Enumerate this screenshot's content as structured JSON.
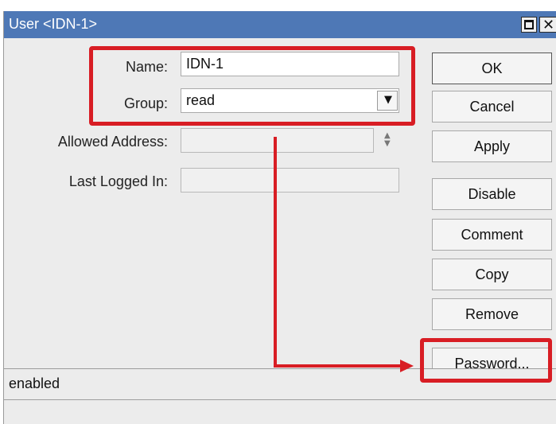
{
  "window": {
    "title": "User <IDN-1>"
  },
  "form": {
    "name": {
      "label": "Name:",
      "value": "IDN-1"
    },
    "group": {
      "label": "Group:",
      "value": "read"
    },
    "allowed_address": {
      "label": "Allowed Address:",
      "value": ""
    },
    "last_logged_in": {
      "label": "Last Logged In:",
      "value": ""
    }
  },
  "buttons": {
    "ok": "OK",
    "cancel": "Cancel",
    "apply": "Apply",
    "disable": "Disable",
    "comment": "Comment",
    "copy": "Copy",
    "remove": "Remove",
    "password": "Password..."
  },
  "status": {
    "text": "enabled"
  },
  "colors": {
    "title_bar": "#4e78b6",
    "highlight": "#d81d24"
  },
  "icons": [
    "maximize-icon",
    "close-icon",
    "dropdown-arrow-icon",
    "up-down-arrows-icon"
  ]
}
